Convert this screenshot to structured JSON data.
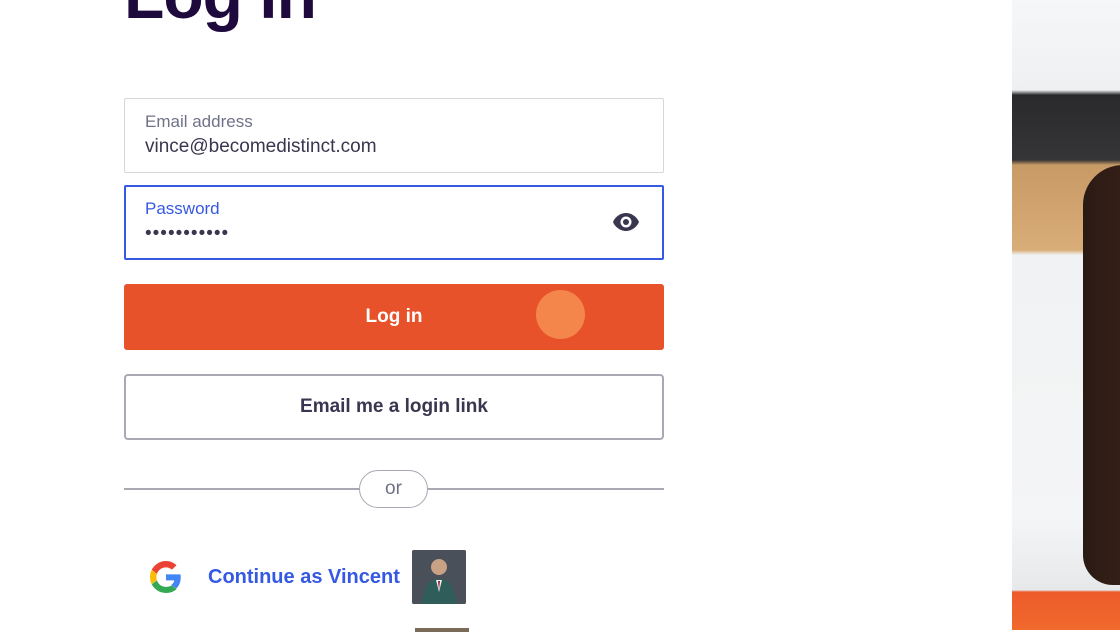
{
  "page": {
    "title": "Log in"
  },
  "email_field": {
    "label": "Email address",
    "value": "vince@becomedistinct.com"
  },
  "password_field": {
    "label": "Password",
    "value": "•••••••••••",
    "toggle_icon": "eye-icon"
  },
  "login_button": {
    "label": "Log in",
    "color": "#e8522b"
  },
  "email_link_button": {
    "label": "Email me a login link"
  },
  "divider": {
    "text": "or"
  },
  "google": {
    "label": "Continue as Vincent",
    "icon": "google-icon",
    "color": "#3659e3"
  },
  "colors": {
    "title": "#1e0a3c",
    "focus": "#3659e3",
    "text": "#39364f"
  }
}
